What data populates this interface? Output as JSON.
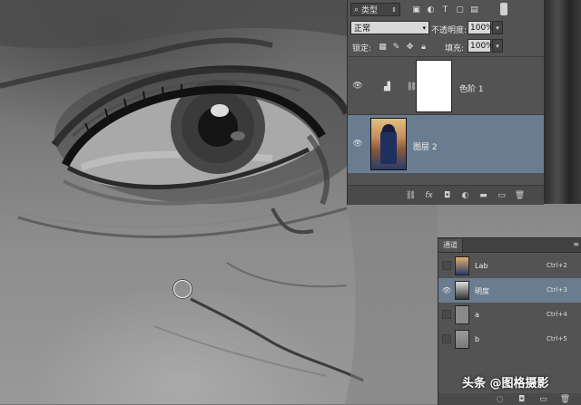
{
  "layers_panel": {
    "filter_kind": "类型",
    "blend_mode": "正常",
    "opacity_label": "不透明度:",
    "opacity_value": "100%",
    "lock_label": "锁定:",
    "fill_label": "填充:",
    "fill_value": "100%",
    "layers": [
      {
        "name": "色阶 1",
        "selected": false,
        "type": "adjustment"
      },
      {
        "name": "图层 2",
        "selected": true,
        "type": "pixel"
      }
    ]
  },
  "channels_panel": {
    "tab": "通道",
    "channels": [
      {
        "name": "Lab",
        "shortcut": "Ctrl+2",
        "selected": false,
        "visible": false
      },
      {
        "name": "明度",
        "shortcut": "Ctrl+3",
        "selected": true,
        "visible": true
      },
      {
        "name": "a",
        "shortcut": "Ctrl+4",
        "selected": false,
        "visible": false
      },
      {
        "name": "b",
        "shortcut": "Ctrl+5",
        "selected": false,
        "visible": false
      }
    ]
  },
  "watermark": "头条 @图格摄影",
  "colors": {
    "panel_bg": "#535353",
    "selection": "#6a7d90"
  }
}
